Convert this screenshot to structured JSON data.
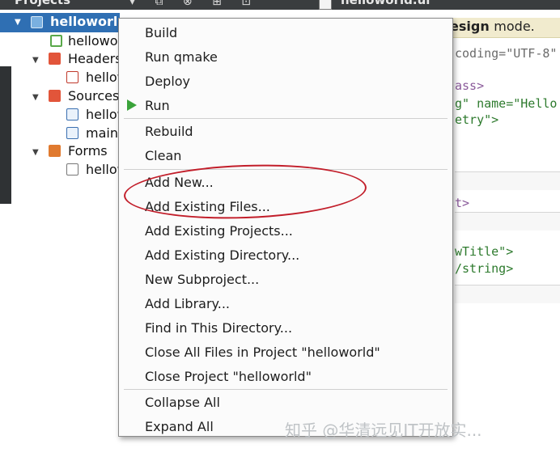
{
  "topbar": {
    "projects_label": "Projects",
    "file_tab": "helloworld.ui"
  },
  "tree": {
    "project": "helloworld",
    "items": [
      {
        "label": "helloworld.pro",
        "icon": "pro-file-icon"
      },
      {
        "label": "Headers",
        "icon": "headers-folder-icon"
      },
      {
        "label": "helloworld.h",
        "icon": "header-file-icon"
      },
      {
        "label": "Sources",
        "icon": "sources-folder-icon"
      },
      {
        "label": "helloworld.cpp",
        "icon": "cpp-file-icon"
      },
      {
        "label": "main.cpp",
        "icon": "cpp-file-icon"
      },
      {
        "label": "Forms",
        "icon": "forms-folder-icon"
      },
      {
        "label": "helloworld.ui",
        "icon": "ui-file-icon"
      }
    ]
  },
  "editor": {
    "banner_bold": "esign",
    "banner_rest": "mode.",
    "lines": [
      "coding=\"UTF-8\"",
      "ass>",
      "g\" name=\"Hello",
      "etry\">",
      "t>",
      "wTitle\">",
      "/string>"
    ]
  },
  "menu": {
    "items": [
      "Build",
      "Run qmake",
      "Deploy",
      "Run",
      "Rebuild",
      "Clean",
      "Add New...",
      "Add Existing Files...",
      "Add Existing Projects...",
      "Add Existing Directory...",
      "New Subproject...",
      "Add Library...",
      "Find in This Directory...",
      "Close All Files in Project \"helloworld\"",
      "Close Project \"helloworld\"",
      "Collapse All",
      "Expand All"
    ]
  },
  "colors": {
    "selection": "#2f6fb3",
    "run_icon": "#3aa33a",
    "highlight": "#c21e2a",
    "banner": "#f1ebce"
  },
  "watermark": "知乎 @华清远见IT开放实..."
}
